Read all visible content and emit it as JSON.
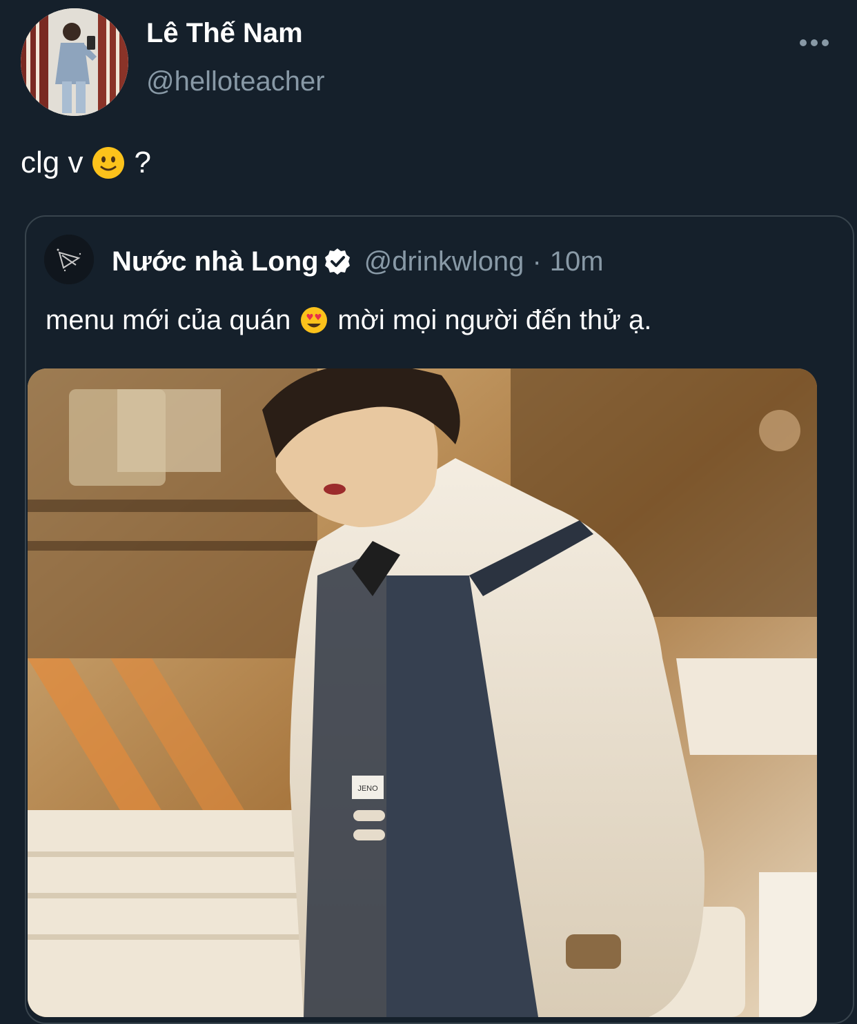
{
  "author": {
    "display_name": "Lê Thế Nam",
    "handle": "@helloteacher",
    "avatar_icon": "profile-photo"
  },
  "more_icon": "more-horizontal-icon",
  "tweet": {
    "text_before": "clg v",
    "emoji": "slightly-smiling-face",
    "text_after": "?"
  },
  "quoted": {
    "display_name": "Nước nhà Long",
    "verified": true,
    "handle": "@drinkwlong",
    "separator": "·",
    "time": "10m",
    "text_before": "menu mới của quán",
    "emoji": "smiling-face-with-heart-eyes",
    "text_after": "mời mọi người đến thử ạ.",
    "media": {
      "description_icon": "barista-photo",
      "name_tag": "JENO"
    }
  },
  "colors": {
    "background": "#15202b",
    "border": "#38444d",
    "secondary_text": "#8899a6",
    "primary_text": "#ffffff"
  }
}
